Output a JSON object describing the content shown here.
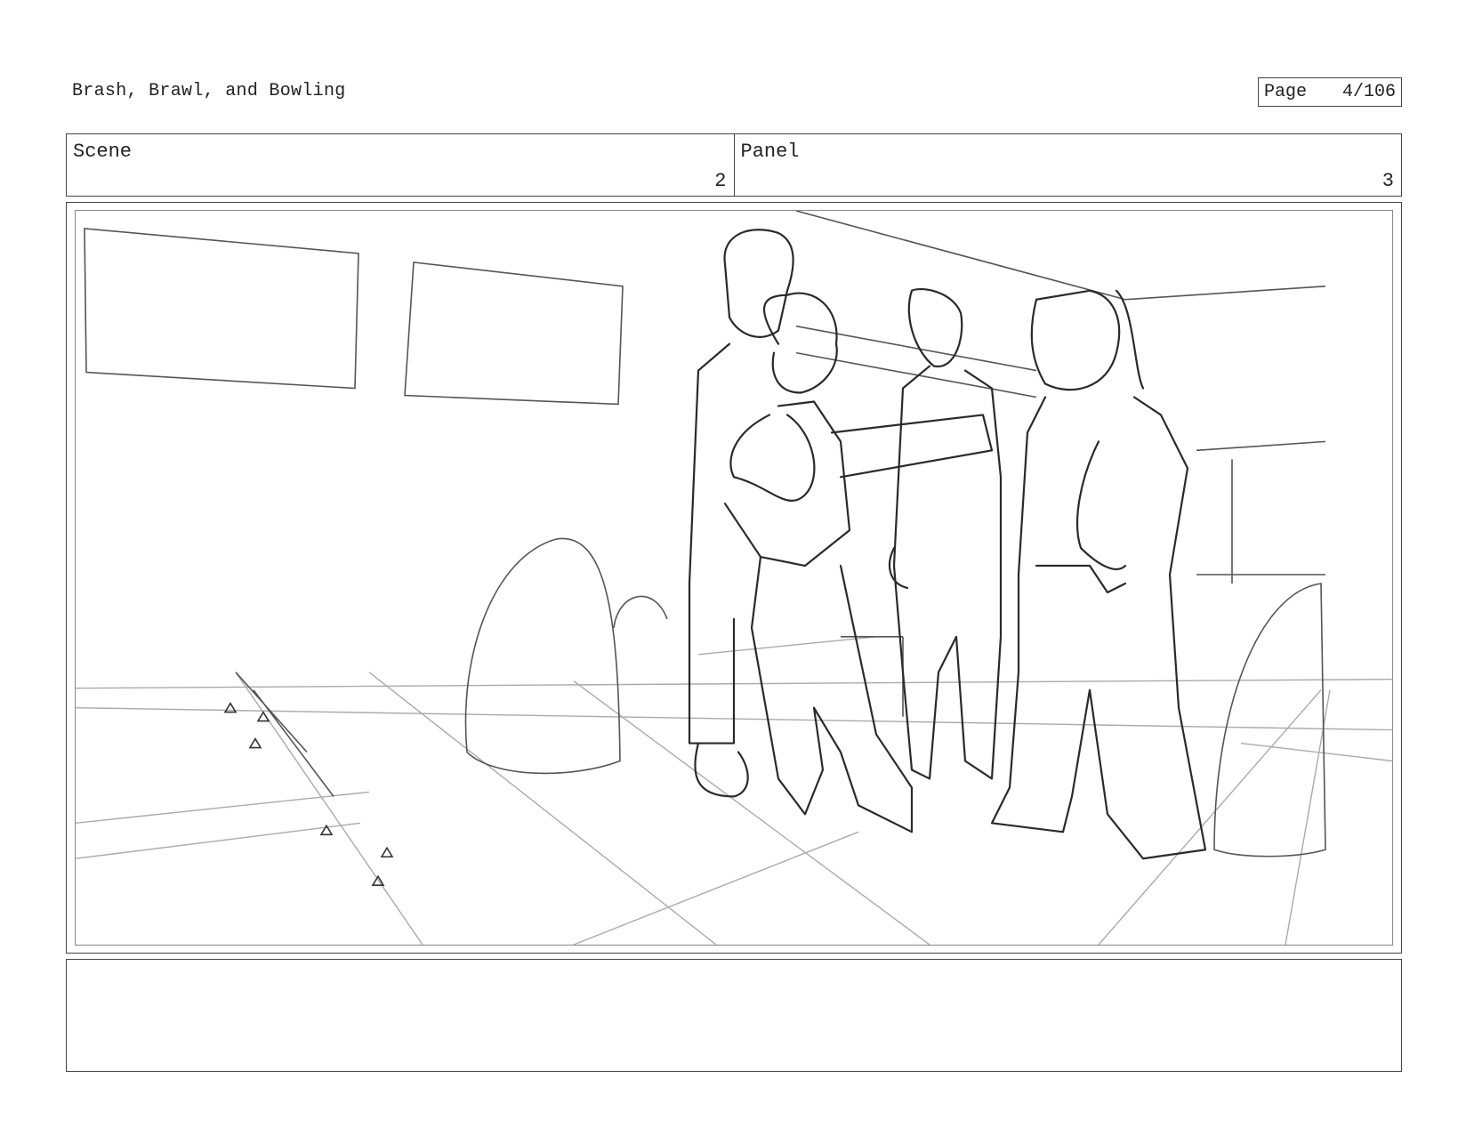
{
  "title": "Brash, Brawl, and Bowling",
  "page": {
    "label": "Page",
    "value": "4/106"
  },
  "scene": {
    "label": "Scene",
    "value": "2"
  },
  "panel": {
    "label": "Panel",
    "value": "3"
  },
  "notes": ""
}
